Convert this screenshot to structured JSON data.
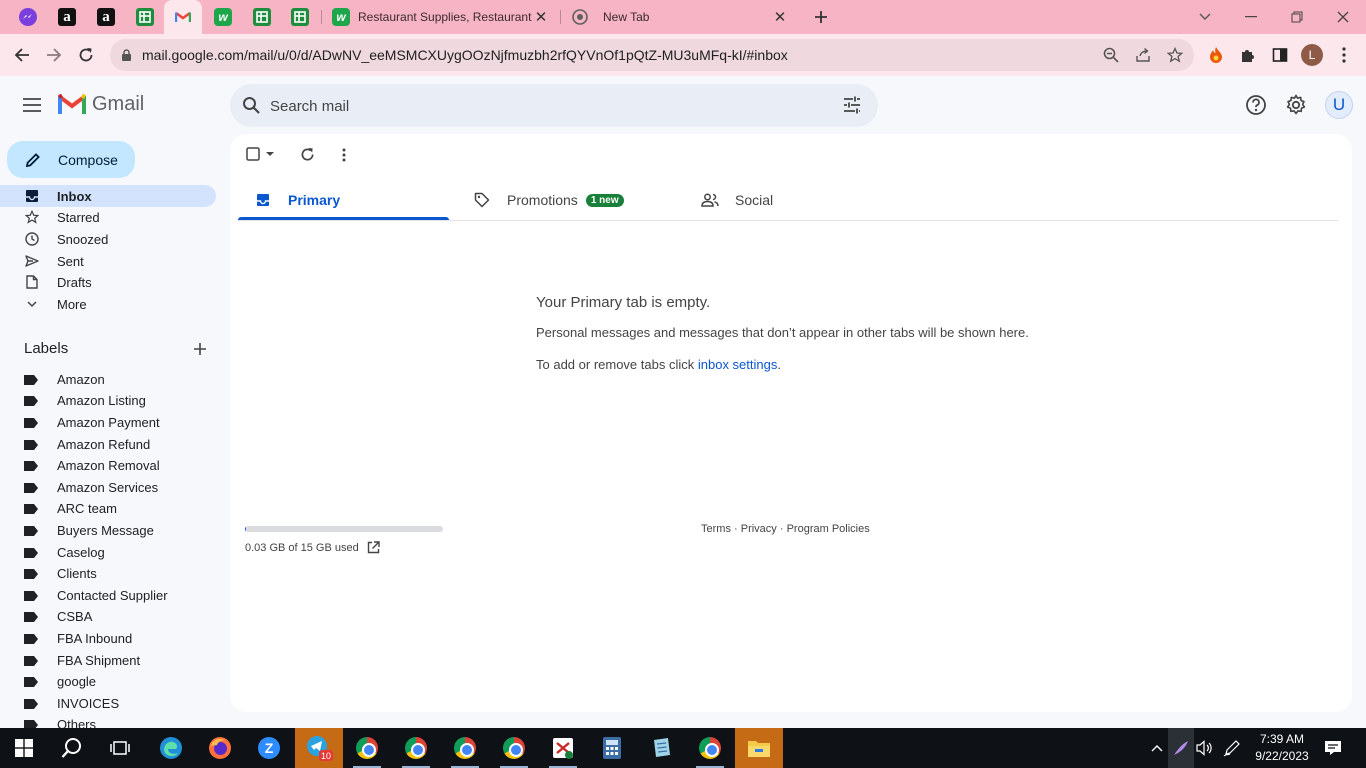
{
  "browser": {
    "tabs": [
      {
        "icon": "messenger-icon"
      },
      {
        "icon": "amazon-icon",
        "glyph": "a"
      },
      {
        "icon": "amazon-icon",
        "glyph": "a"
      },
      {
        "icon": "google-sheets-icon"
      },
      {
        "icon": "gmail-icon",
        "active": true
      },
      {
        "icon": "webstaurant-icon",
        "glyph": "w"
      },
      {
        "icon": "google-sheets-icon"
      },
      {
        "icon": "google-sheets-icon"
      },
      {
        "icon": "webstaurant-icon",
        "glyph": "w",
        "title": "Restaurant Supplies, Restaurant S"
      },
      {
        "icon": "chrome-icon",
        "title": "New Tab"
      }
    ],
    "url": "mail.google.com/mail/u/0/d/ADwNV_eeMSMCXUygOOzNjfmuzbh2rfQYVnOf1pQtZ-MU3uMFq-kI/#inbox",
    "profile_initial": "L"
  },
  "gmail": {
    "logo_text": "Gmail",
    "search_placeholder": "Search mail",
    "account_initial": "U",
    "compose_label": "Compose",
    "nav": [
      {
        "label": "Inbox",
        "icon": "inbox-icon",
        "active": true
      },
      {
        "label": "Starred",
        "icon": "star-icon"
      },
      {
        "label": "Snoozed",
        "icon": "clock-icon"
      },
      {
        "label": "Sent",
        "icon": "send-icon"
      },
      {
        "label": "Drafts",
        "icon": "draft-icon"
      },
      {
        "label": "More",
        "icon": "chevron-down-icon"
      }
    ],
    "labels_heading": "Labels",
    "labels": [
      "Amazon",
      "Amazon Listing",
      "Amazon Payment",
      "Amazon Refund",
      "Amazon Removal",
      "Amazon Services",
      "ARC team",
      "Buyers Message",
      "Caselog",
      "Clients",
      "Contacted Supplier",
      "CSBA",
      "FBA Inbound",
      "FBA Shipment",
      "google",
      "INVOICES",
      "Others"
    ],
    "tabs": [
      {
        "label": "Primary",
        "icon": "inbox-icon",
        "active": true
      },
      {
        "label": "Promotions",
        "icon": "tag-icon",
        "badge": "1 new"
      },
      {
        "label": "Social",
        "icon": "people-icon"
      }
    ],
    "empty": {
      "title": "Your Primary tab is empty.",
      "description": "Personal messages and messages that don’t appear in other tabs will be shown here.",
      "hint_prefix": "To add or remove tabs click ",
      "hint_link": "inbox settings",
      "hint_suffix": "."
    },
    "storage": {
      "text": "0.03 GB of 15 GB used",
      "used_fraction": 0.002
    },
    "footer": {
      "terms": "Terms",
      "privacy": "Privacy",
      "policies": "Program Policies",
      "separator": " · "
    }
  },
  "taskbar": {
    "apps": [
      "start-icon",
      "search-icon",
      "task-view-icon",
      "edge-icon",
      "firefox-icon",
      "zoom-icon",
      "telegram-icon",
      "chrome-icon",
      "chrome-icon",
      "chrome-icon",
      "chrome-icon",
      "excel-icon",
      "calculator-icon",
      "notepad-icon",
      "chrome-icon",
      "file-explorer-icon"
    ],
    "telegram_badge": "10",
    "time": "7:39 AM",
    "date": "9/22/2023"
  },
  "colors": {
    "accent": "#0b57d0",
    "compose": "#c2e7ff",
    "tabstrip": "#f6b4c4",
    "badge": "#188038"
  }
}
